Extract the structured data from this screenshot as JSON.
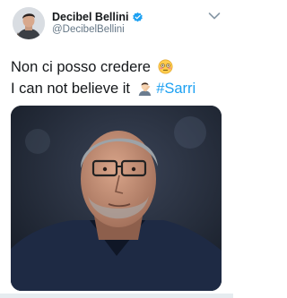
{
  "tweet": {
    "author": {
      "display_name": "Decibel Bellini",
      "handle": "@DecibelBellini",
      "verified": true
    },
    "text_line1": "Non ci posso credere",
    "text_line1_emoji": "flushed-face-emoji",
    "text_line2": "I can not believe it",
    "text_line2_emoji": "man-facepalming-emoji",
    "hashtag": "#Sarri",
    "menu_icon": "chevron-down-icon"
  },
  "colors": {
    "link": "#1da1f2",
    "verified_badge": "#1da1f2",
    "secondary_text": "#657786"
  }
}
